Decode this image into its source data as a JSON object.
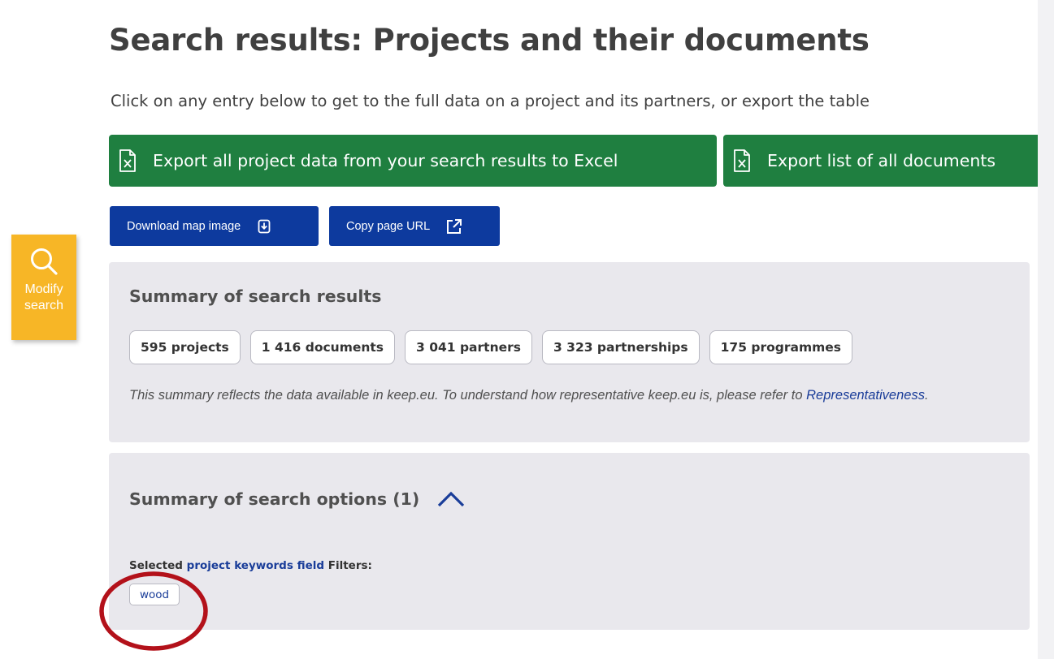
{
  "header": {
    "title": "Search results: Projects and their documents",
    "intro": "Click on any entry below to get to the full data on a project and its partners, or export the table"
  },
  "exports": {
    "project_data_label": "Export all project data from your search results to Excel",
    "documents_label": "Export list of all documents"
  },
  "actions": {
    "download_map_label": "Download map image",
    "copy_url_label": "Copy page URL"
  },
  "sidebar": {
    "modify_search_label": "Modify search"
  },
  "summary": {
    "title": "Summary of search results",
    "stats": [
      "595 projects",
      "1 416 documents",
      "3 041 partners",
      "3 323 partnerships",
      "175 programmes"
    ],
    "note_text": "This summary reflects the data available in keep.eu. To understand how representative keep.eu is, please refer to",
    "note_link": "Representativeness",
    "note_end": "."
  },
  "search_options": {
    "title": "Summary of search options (1)",
    "expanded": true,
    "filters_prefix": "Selected",
    "filters_field": "project keywords field",
    "filters_suffix": "Filters:",
    "tags": [
      "wood"
    ]
  },
  "colors": {
    "export_green": "#1f7f40",
    "action_blue": "#0d3a9e",
    "modify_yellow": "#f7b626",
    "panel_grey": "#e9e8ed",
    "link_blue": "#1a3d99",
    "annotation_red": "#b3111a"
  },
  "icons": {
    "export": "excel-file-icon",
    "download": "download-icon",
    "copy": "external-link-icon",
    "modify": "search-icon",
    "toggle": "chevron-up-icon"
  }
}
